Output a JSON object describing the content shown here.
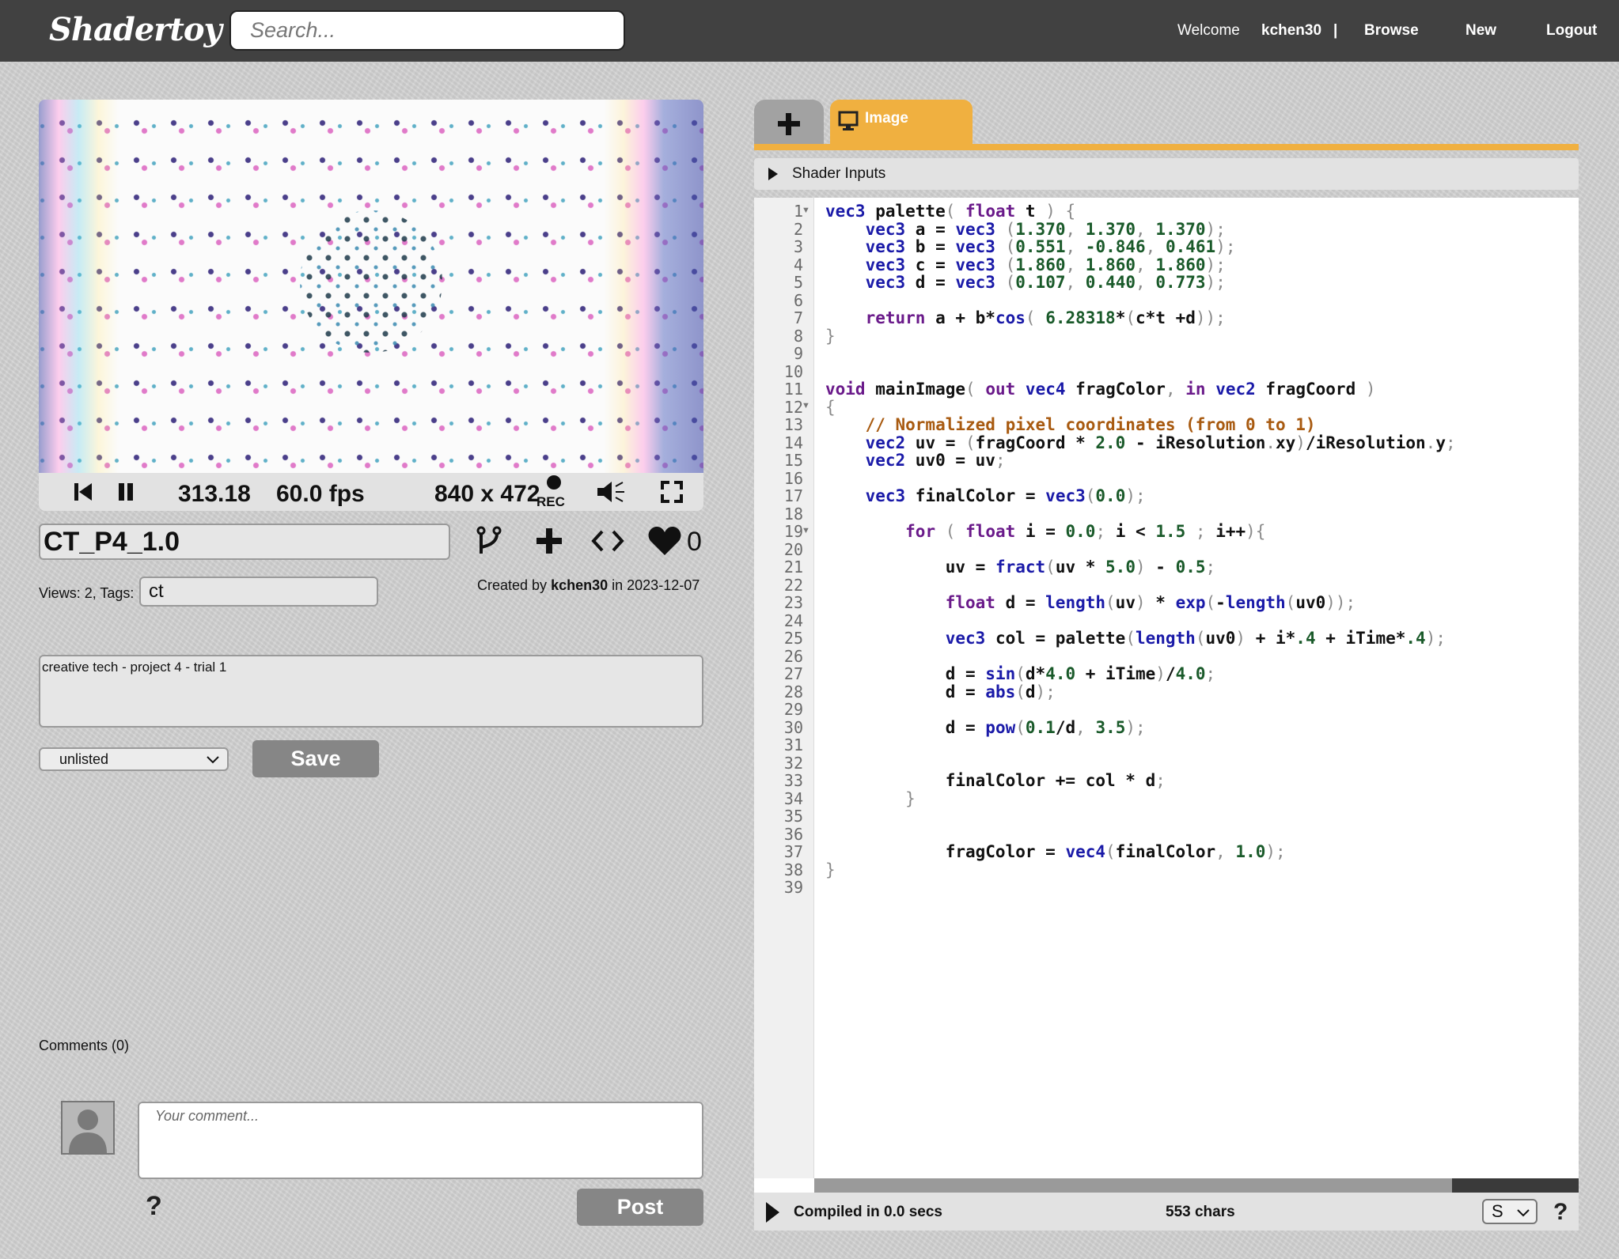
{
  "header": {
    "logo": "Shadertoy",
    "search_placeholder": "Search...",
    "welcome": "Welcome",
    "username": "kchen30",
    "separator": "|",
    "browse": "Browse",
    "new": "New",
    "logout": "Logout"
  },
  "player": {
    "time": "313.18",
    "fps": "60.0 fps",
    "resolution": "840 x 472",
    "rec_label": "REC"
  },
  "shader": {
    "name": "CT_P4_1.0",
    "likes": "0",
    "views_tags_label": "Views: 2, Tags:",
    "tags": "ct",
    "created_prefix": "Created by",
    "author": "kchen30",
    "created_date": "in 2023-12-07",
    "description": "creative tech - project 4 - trial 1",
    "privacy": "unlisted",
    "save_label": "Save"
  },
  "comments": {
    "label": "Comments (0)",
    "placeholder": "Your comment...",
    "help": "?",
    "post_label": "Post"
  },
  "editor": {
    "tab_image": "Image",
    "shader_inputs": "Shader Inputs",
    "compiled": "Compiled in 0.0 secs",
    "chars": "553 chars",
    "font_size": "S",
    "help": "?",
    "accent_color": "#f0b040",
    "line_count": 39
  },
  "icons": {
    "rewind": "skip-back-icon",
    "pause": "pause-icon",
    "rec": "record-icon",
    "volume": "volume-icon",
    "fullscreen": "fullscreen-icon",
    "fork": "fork-icon",
    "add": "plus-icon",
    "embed": "code-embed-icon",
    "like": "heart-icon"
  }
}
